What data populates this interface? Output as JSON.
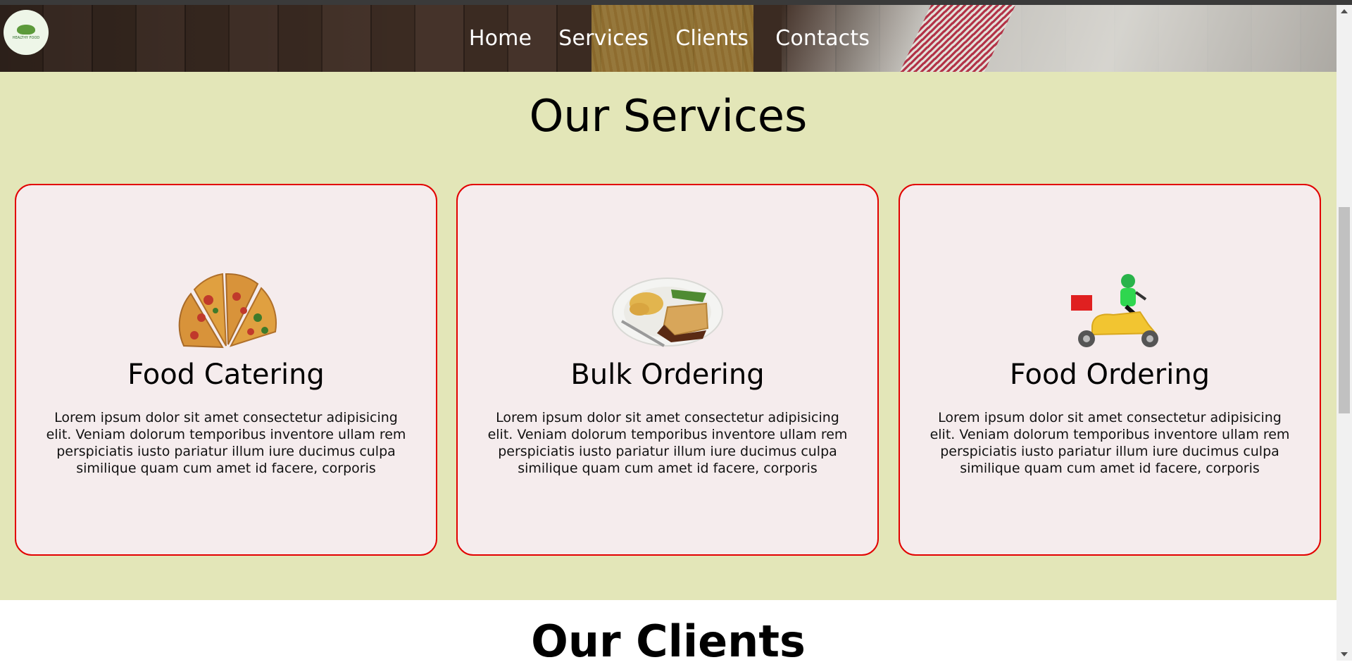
{
  "nav": {
    "logo_text": "HEALTHY FOOD",
    "items": [
      {
        "label": "Home"
      },
      {
        "label": "Services"
      },
      {
        "label": "Clients"
      },
      {
        "label": "Contacts"
      }
    ]
  },
  "services": {
    "title": "Our Services",
    "cards": [
      {
        "title": "Food Catering",
        "image": "pizza-slices-image",
        "text": "Lorem ipsum dolor sit amet consectetur adipisicing elit. Veniam dolorum temporibus inventore ullam rem perspiciatis iusto pariatur illum iure ducimus culpa similique quam cum amet id facere, corporis"
      },
      {
        "title": "Bulk Ordering",
        "image": "meat-pie-plate-image",
        "text": "Lorem ipsum dolor sit amet consectetur adipisicing elit. Veniam dolorum temporibus inventore ullam rem perspiciatis iusto pariatur illum iure ducimus culpa similique quam cum amet id facere, corporis"
      },
      {
        "title": "Food Ordering",
        "image": "delivery-scooter-image",
        "text": "Lorem ipsum dolor sit amet consectetur adipisicing elit. Veniam dolorum temporibus inventore ullam rem perspiciatis iusto pariatur illum iure ducimus culpa similique quam cum amet id facere, corporis"
      }
    ],
    "colors": {
      "section_bg": "#e3e6b8",
      "card_bg": "#f5eced",
      "card_border": "#e20000"
    }
  },
  "clients": {
    "title": "Our Clients"
  }
}
